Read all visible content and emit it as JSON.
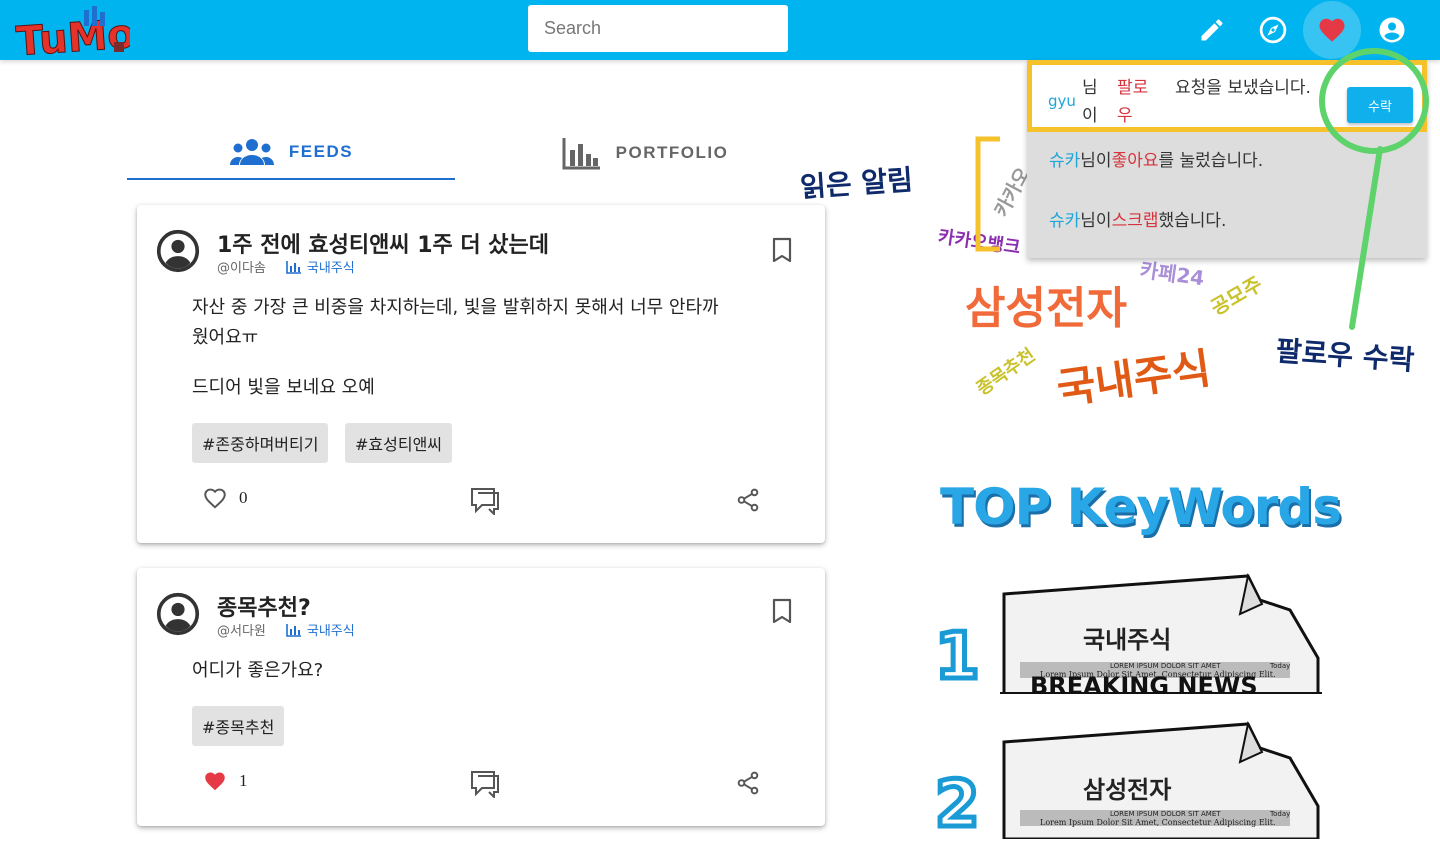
{
  "app": {
    "logo_text": "TuMo",
    "search_placeholder": "Search"
  },
  "header_icons": [
    "edit-icon",
    "compass-icon",
    "heart-icon",
    "account-icon"
  ],
  "tabs": [
    {
      "label": "FEEDS",
      "icon": "group-icon",
      "active": true
    },
    {
      "label": "PORTFOLIO",
      "icon": "bar-chart-icon",
      "active": false
    }
  ],
  "posts": [
    {
      "title": "1주 전에 효성티앤씨 1주 더 샀는데",
      "author": "@이다솜",
      "category": "국내주식",
      "body": [
        "자산 중 가장 큰 비중을 차지하는데, 빛을 발휘하지 못해서 너무 안타까",
        "웠어요ㅠ",
        "드디어 빛을 보네요 오예"
      ],
      "tags": [
        "#존중하며버티기",
        "#효성티앤씨"
      ],
      "likes": "0",
      "liked": false
    },
    {
      "title": "종목추천?",
      "author": "@서다원",
      "category": "국내주식",
      "body": [
        "어디가 좋은가요?"
      ],
      "tags": [
        "#종목추천"
      ],
      "likes": "1",
      "liked": true
    }
  ],
  "notifications": {
    "first": {
      "user": "gyu",
      "part1": "님이",
      "part2": "팔로우",
      "part3": "요청을 보냈습니다.",
      "button": "수락"
    },
    "items": [
      {
        "user": "슈카",
        "mid": "님이",
        "red": "좋아요",
        "end": "를 눌렀습니다."
      },
      {
        "user": "슈카",
        "mid": "님이",
        "red": "스크랩",
        "end": "했습니다."
      }
    ]
  },
  "annotations": {
    "read_alert": "읽은 알림",
    "follow_accept": "팔로우 수락"
  },
  "word_cloud": [
    "카카오",
    "카카오뱅크",
    "카페24",
    "삼성전자",
    "공모주",
    "종목추천",
    "국내주식"
  ],
  "top_keywords": {
    "heading": "TOP KeyWords",
    "items": [
      {
        "rank": "1",
        "keyword": "국내주식"
      },
      {
        "rank": "2",
        "keyword": "삼성전자"
      }
    ],
    "news_small_1": "LOREM IPSUM DOLOR SIT AMET",
    "news_small_2": "Lorem Ipsum Dolor Sit Amet, Consectetur Adipiscing Elit.",
    "news_small_3": "Today",
    "news_big": "BREAKING NEWS"
  },
  "colors": {
    "header": "#00b4f0",
    "accent": "#1f6fd0",
    "like": "#e53946",
    "highlight": "#f5c22c",
    "annotation_green": "#5fd36b"
  }
}
